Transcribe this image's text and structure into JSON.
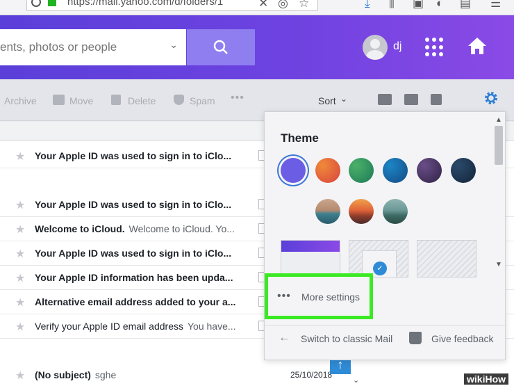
{
  "browser": {
    "url": "https://mail.yahoo.com/d/folders/1"
  },
  "header": {
    "search_placeholder": "ents, photos or people",
    "user_name": "dj"
  },
  "toolbar": {
    "archive": "Archive",
    "move": "Move",
    "delete": "Delete",
    "spam": "Spam",
    "more": "•••",
    "sort": "Sort"
  },
  "messages": [
    {
      "subject": "Your Apple ID was used to sign in to iClo...",
      "snippet": "",
      "bold": true,
      "date": ""
    },
    {
      "subject": "Your Apple ID was used to sign in to iClo...",
      "snippet": "",
      "bold": true,
      "date": ""
    },
    {
      "subject": "Welcome to iCloud.",
      "snippet": "Welcome to iCloud. Yo...",
      "bold": true,
      "date": ""
    },
    {
      "subject": "Your Apple ID was used to sign in to iClo...",
      "snippet": "",
      "bold": true,
      "date": ""
    },
    {
      "subject": "Your Apple ID information has been upda...",
      "snippet": "",
      "bold": true,
      "date": ""
    },
    {
      "subject": "Alternative email address added to your a...",
      "snippet": "",
      "bold": true,
      "date": ""
    },
    {
      "subject": "Verify your Apple ID email address",
      "snippet": "You have...",
      "bold": false,
      "date": ""
    },
    {
      "subject": "(No subject)",
      "snippet": "sghe",
      "bold": true,
      "date": "25/10/2018"
    }
  ],
  "settings_popup": {
    "theme_title": "Theme",
    "theme_colors": [
      "#6b5de4",
      "#e85b3a",
      "#2e9a5c",
      "#1565a8",
      "#4a3a68",
      "#1c3552"
    ],
    "theme_images": [
      "beach",
      "sunset",
      "mountains"
    ],
    "more_settings": "More settings",
    "more_dots": "•••",
    "switch_classic": "Switch to classic Mail",
    "give_feedback": "Give feedback"
  },
  "watermark": {
    "wiki": "wiki",
    "how": "How"
  },
  "colors": {
    "header_purple": "#5b3fd9",
    "highlight_green": "#3aea22",
    "accent_blue": "#2f8bd6"
  }
}
